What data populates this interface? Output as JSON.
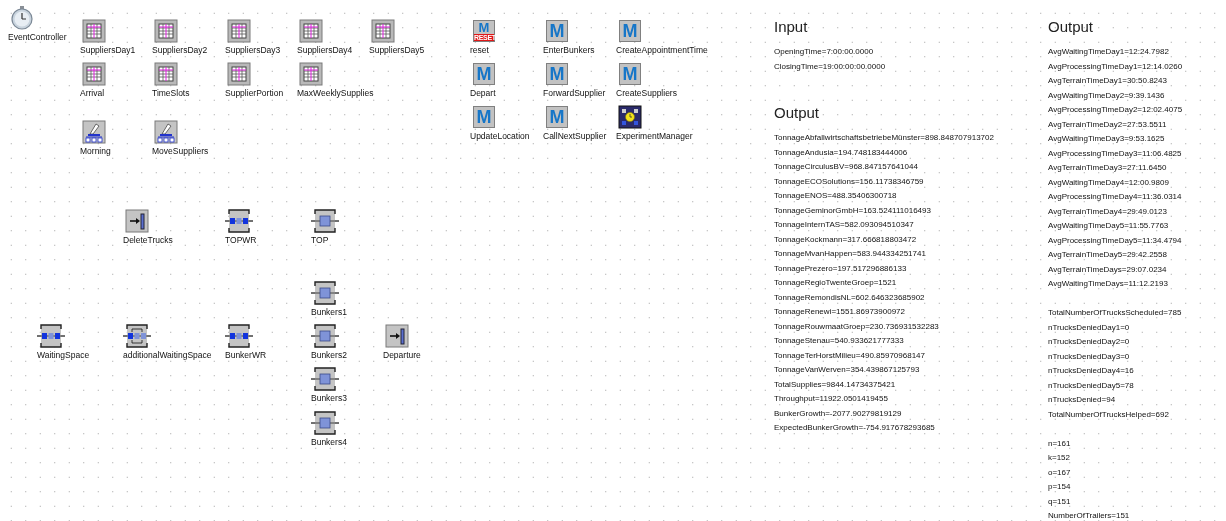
{
  "objects": [
    {
      "kind": "clock",
      "label": "EventController"
    },
    {
      "kind": "table",
      "label": "SuppliersDay1"
    },
    {
      "kind": "table",
      "label": "SuppliersDay2"
    },
    {
      "kind": "table",
      "label": "SuppliersDay3"
    },
    {
      "kind": "table",
      "label": "SuppliersDay4"
    },
    {
      "kind": "table",
      "label": "SuppliersDay5"
    },
    {
      "kind": "table",
      "label": "Arrival"
    },
    {
      "kind": "table",
      "label": "TimeSlots"
    },
    {
      "kind": "table",
      "label": "SupplierPortion"
    },
    {
      "kind": "table",
      "label": "MaxWeeklySupplies"
    },
    {
      "kind": "generator",
      "label": "Morning"
    },
    {
      "kind": "generator",
      "label": "MoveSuppliers"
    },
    {
      "kind": "method",
      "label": "reset",
      "glyph": "M",
      "badge": "RESET"
    },
    {
      "kind": "method",
      "label": "EnterBunkers",
      "glyph": "M"
    },
    {
      "kind": "method",
      "label": "CreateAppointmentTime",
      "glyph": "M"
    },
    {
      "kind": "method",
      "label": "Depart",
      "glyph": "M"
    },
    {
      "kind": "method",
      "label": "ForwardSupplier",
      "glyph": "M"
    },
    {
      "kind": "method",
      "label": "CreateSuppliers",
      "glyph": "M"
    },
    {
      "kind": "method",
      "label": "UpdateLocation",
      "glyph": "M"
    },
    {
      "kind": "method",
      "label": "CallNextSupplier",
      "glyph": "M"
    },
    {
      "kind": "experiment",
      "label": "ExperimentManager"
    },
    {
      "kind": "sink",
      "label": "DeleteTrucks"
    },
    {
      "kind": "buffer",
      "label": "TOPWR"
    },
    {
      "kind": "station",
      "label": "TOP"
    },
    {
      "kind": "station",
      "label": "Bunkers1"
    },
    {
      "kind": "buffer",
      "label": "WaitingSpace"
    },
    {
      "kind": "loop",
      "label": "additionalWaitingSpace"
    },
    {
      "kind": "buffer",
      "label": "BunkerWR"
    },
    {
      "kind": "station",
      "label": "Bunkers2"
    },
    {
      "kind": "sink",
      "label": "Departure"
    },
    {
      "kind": "station",
      "label": "Bunkers3"
    },
    {
      "kind": "station",
      "label": "Bunkers4"
    }
  ],
  "input": {
    "title": "Input",
    "lines": [
      "OpeningTime=7:00:00.0000",
      "ClosingTime=19:00:00:00.0000"
    ]
  },
  "output_left": {
    "title": "Output",
    "lines": [
      "TonnageAbfallwirtschaftsbetriebeMünster=898.848707913702",
      "TonnageAndusia=194.748183444006",
      "TonnageCirculusBV=968.847157641044",
      "TonnageECOSolutions=156.11738346759",
      "TonnageENOS=488.35406300718",
      "TonnageGeminorGmbH=163.524111016493",
      "TonnageInternTAS=582.093094510347",
      "TonnageKockmann=317.666818803472",
      "TonnageMvanHappen=583.944334251741",
      "TonnagePrezero=197.517296886133",
      "TonnageRegioTwenteGroep=1521",
      "TonnageRemondisNL=602.646323685902",
      "TonnageRenewi=1551.86973900972",
      "TonnageRouwmaatGroep=230.736931532283",
      "TonnageStenau=540.933621777333",
      "TonnageTerHorstMilieu=490.85970968147",
      "TonnageVanWerven=354.439867125793",
      "TotalSupplies=9844.14734375421",
      "Throughput=11922.0501419455",
      "BunkerGrowth=-2077.90279819129",
      "ExpectedBunkerGrowth=-754.917678293685"
    ]
  },
  "output_right": {
    "title": "Output",
    "groups": [
      [
        "AvgWaitingTimeDay1=12:24.7982",
        "AvgProcessingTimeDay1=12:14.0260",
        "AvgTerrainTimeDay1=30:50.8243",
        "AvgWaitingTimeDay2=9:39.1436",
        "AvgProcessingTimeDay2=12:02.4075",
        "AvgTerrainTimeDay2=27:53.5511",
        "AvgWaitingTimeDay3=9:53.1625",
        "AvgProcessingTimeDay3=11:06.4825",
        "AvgTerrainTimeDay3=27:11.6450",
        "AvgWaitingTimeDay4=12:00.9809",
        "AvgProcessingTimeDay4=11:36.0314",
        "AvgTerrainTimeDay4=29:49.0123",
        "AvgWaitingTimeDay5=11:55.7763",
        "AvgProcessingTimeDay5=11:34.4794",
        "AvgTerrainTimeDay5=29:42.2558",
        "AvgTerrainTimeDays=29:07.0234",
        "AvgWaitingTimeDays=11:12.2193"
      ],
      [
        "TotalNumberOfTrucksScheduled=785",
        "nTrucksDeniedDay1=0",
        "nTrucksDeniedDay2=0",
        "nTrucksDeniedDay3=0",
        "nTrucksDeniedDay4=16",
        "nTrucksDeniedDay5=78",
        "nTrucksDenied=94",
        "TotalNumberOfTrucksHelped=692"
      ],
      [
        "n=161",
        "k=152",
        "o=167",
        "p=154",
        "q=151",
        "NumberOfTrailers=151"
      ]
    ]
  }
}
